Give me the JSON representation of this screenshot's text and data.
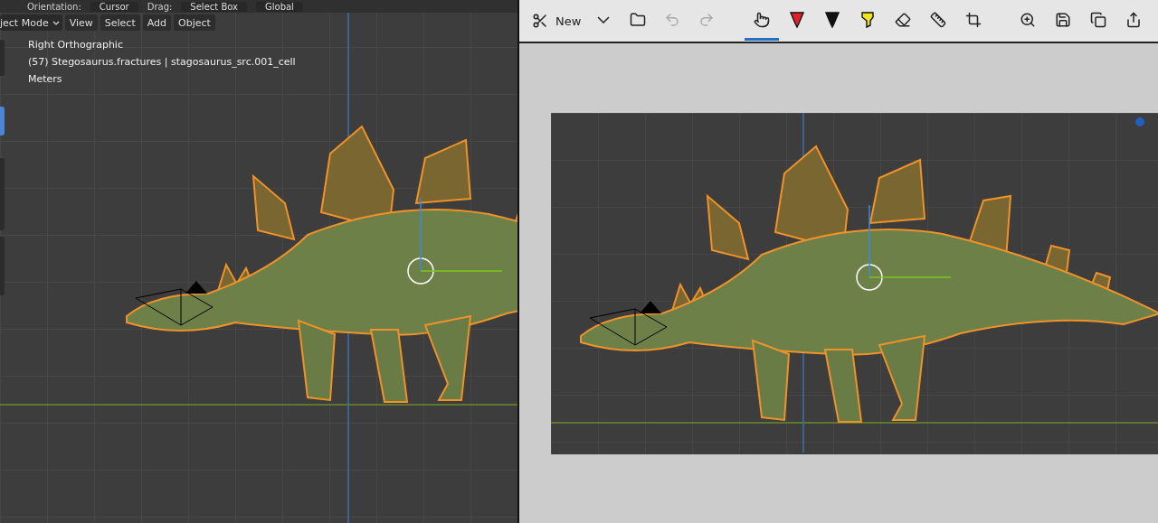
{
  "blender": {
    "header": {
      "orientation_label": "Orientation:",
      "orientation": "Cursor",
      "drag_label": "Drag:",
      "drag": "Select Box",
      "transform": "Global"
    },
    "menu": {
      "mode": "ject Mode",
      "items": [
        "View",
        "Select",
        "Add",
        "Object"
      ]
    },
    "overlay": [
      "Right Orthographic",
      "(57) Stegosaurus.fractures | stagosaurus_src.001_cell",
      "Meters"
    ]
  },
  "sketch": {
    "new_label": "New",
    "history": [
      {
        "kind": "undo",
        "disabled": true
      },
      {
        "kind": "redo",
        "disabled": true
      }
    ],
    "tools": [
      {
        "kind": "touch",
        "selected": true
      },
      {
        "kind": "pen",
        "color": "#e0202a",
        "selected": false
      },
      {
        "kind": "pen",
        "color": "#111111",
        "selected": false
      },
      {
        "kind": "highlighter",
        "color": "#f2e51c",
        "selected": false
      },
      {
        "kind": "eraser",
        "selected": false
      },
      {
        "kind": "ruler",
        "selected": false
      },
      {
        "kind": "crop",
        "selected": false
      }
    ],
    "actions": [
      {
        "kind": "zoom"
      },
      {
        "kind": "save"
      },
      {
        "kind": "copy"
      },
      {
        "kind": "share"
      }
    ]
  }
}
